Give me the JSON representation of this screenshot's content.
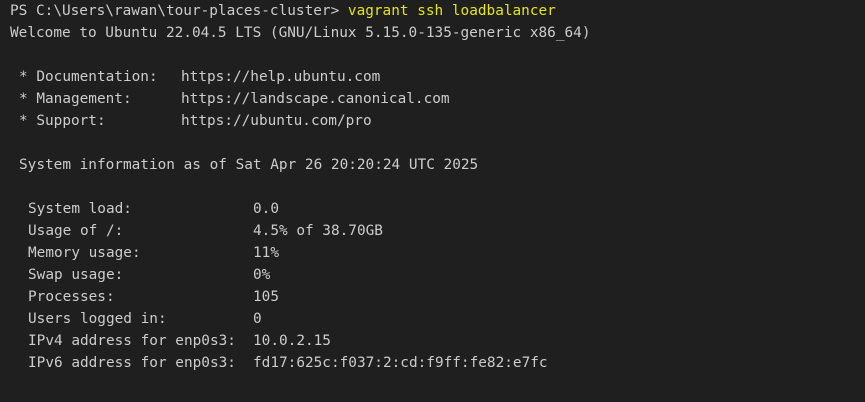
{
  "terminal": {
    "prompt": "PS C:\\Users\\rawan\\tour-places-cluster>",
    "command": "vagrant ssh loadbalancer",
    "welcome": "Welcome to Ubuntu 22.04.5 LTS (GNU/Linux 5.15.0-135-generic x86_64)",
    "motd_links": [
      {
        "label": "* Documentation:",
        "url": "https://help.ubuntu.com"
      },
      {
        "label": "* Management:",
        "url": "https://landscape.canonical.com"
      },
      {
        "label": "* Support:",
        "url": "https://ubuntu.com/pro"
      }
    ],
    "sysinfo_header": "System information as of Sat Apr 26 20:20:24 UTC 2025",
    "sysinfo": [
      {
        "label": "System load:",
        "value": "0.0"
      },
      {
        "label": "Usage of /:",
        "value": "4.5% of 38.70GB"
      },
      {
        "label": "Memory usage:",
        "value": "11%"
      },
      {
        "label": "Swap usage:",
        "value": "0%"
      },
      {
        "label": "Processes:",
        "value": "105"
      },
      {
        "label": "Users logged in:",
        "value": "0"
      },
      {
        "label": "IPv4 address for enp0s3:",
        "value": "10.0.2.15"
      },
      {
        "label": "IPv6 address for enp0s3:",
        "value": "fd17:625c:f037:2:cd:f9ff:fe82:e7fc"
      }
    ]
  }
}
